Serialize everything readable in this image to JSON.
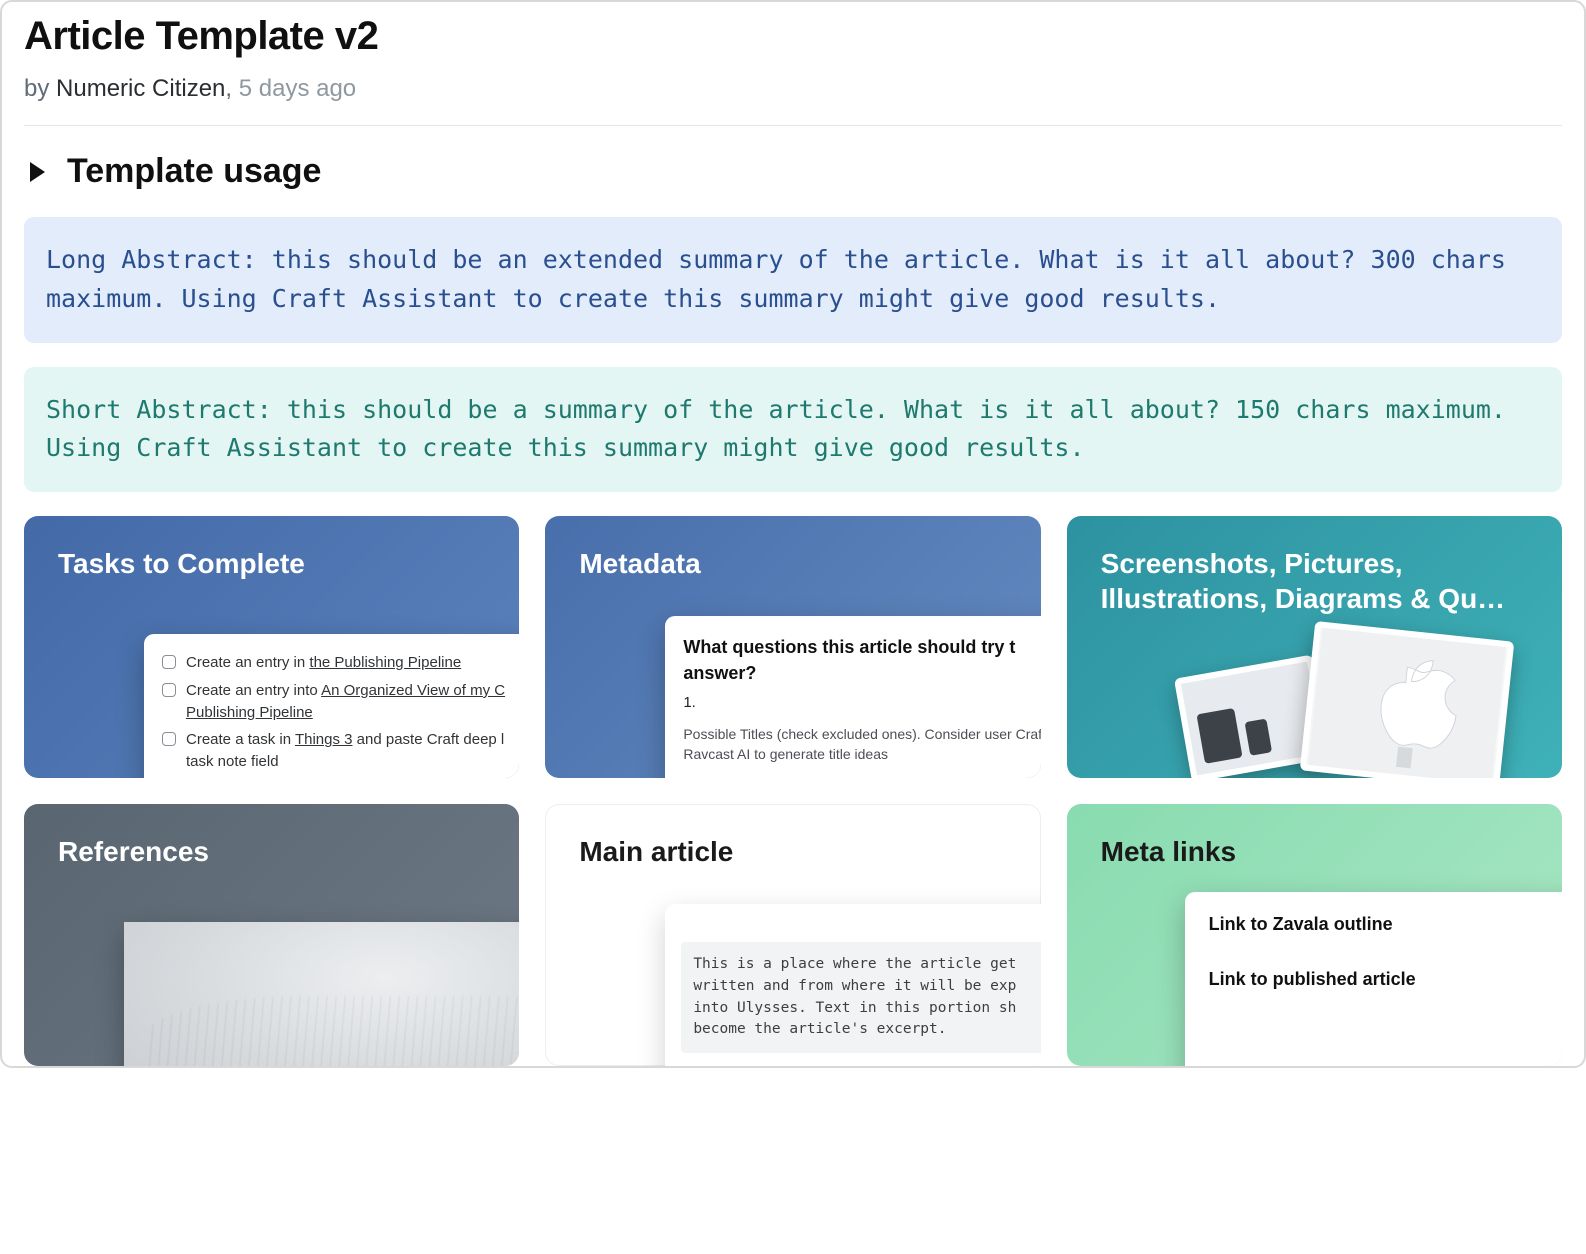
{
  "header": {
    "title": "Article Template v2",
    "byline_prefix": "by ",
    "author": "Numeric Citizen",
    "separator": ", ",
    "date": "5 days ago"
  },
  "section": {
    "usage_heading": "Template usage"
  },
  "callouts": {
    "long_abstract": "Long Abstract: this should be an extended summary of the article. What is it all about? 300 chars maximum. Using Craft Assistant to create this summary might give good results.",
    "short_abstract": "Short Abstract: this should be a summary of the article. What is it all about? 150 chars maximum. Using Craft Assistant to create this summary might give good results."
  },
  "cards": {
    "tasks": {
      "title": "Tasks to Complete",
      "items": [
        {
          "pre": "Create an entry in ",
          "link": "the Publishing Pipeline",
          "post": ""
        },
        {
          "pre": "Create an entry into ",
          "link": "An Organized View of my C",
          "post": "",
          "line2link": "Publishing Pipeline"
        },
        {
          "pre": "Create a task in ",
          "link": "Things 3",
          "post": " and paste Craft deep l",
          "line2": "task note field"
        }
      ]
    },
    "metadata": {
      "title": "Metadata",
      "question": "What questions this article should try t answer?",
      "ordinal": "1.",
      "note": "Possible Titles (check excluded ones). Consider user Craft Ravcast AI to generate title ideas"
    },
    "screenshots": {
      "title": "Screenshots, Pictures, Illustrations, Diagrams & Qu…"
    },
    "references": {
      "title": "References"
    },
    "main_article": {
      "title": "Main article",
      "excerpt": "This is a place where the article get written and from where it will be exp into Ulysses. Text in this portion sh become the article's excerpt."
    },
    "meta_links": {
      "title": "Meta links",
      "links": [
        "Link to Zavala outline",
        "Link to published article"
      ]
    }
  }
}
